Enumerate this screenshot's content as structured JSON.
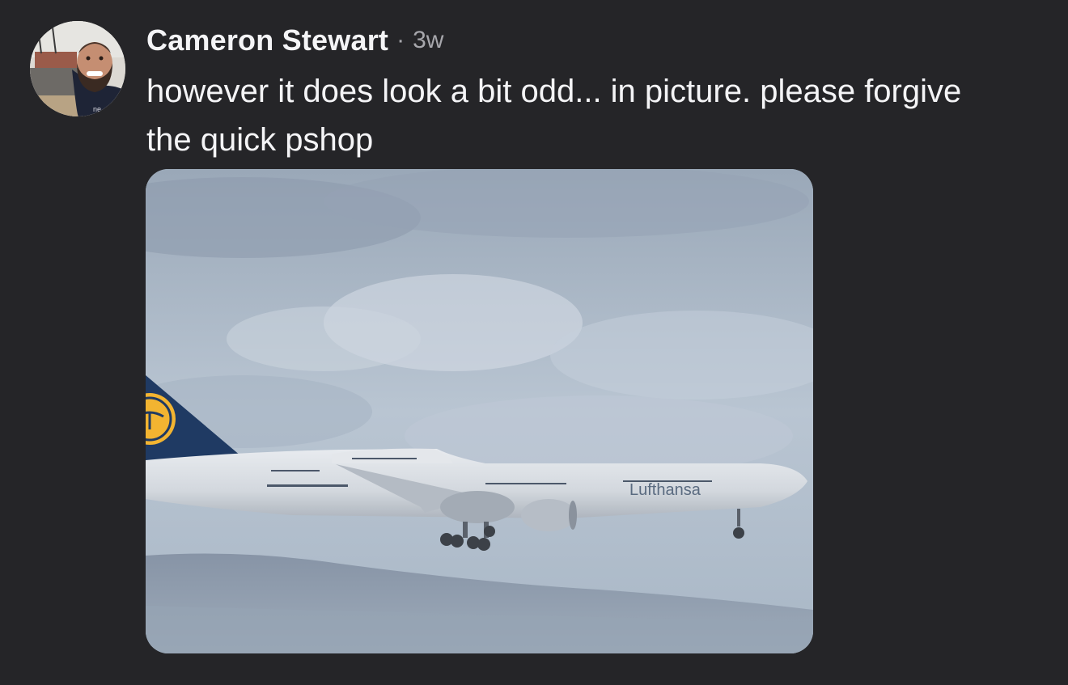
{
  "post": {
    "author": "Cameron Stewart",
    "separator": "·",
    "timestamp": "3w",
    "message": "however it does look a bit odd... in picture. please forgive the quick pshop"
  },
  "avatar": {
    "icon": "profile-photo",
    "shirt_text": "ne"
  },
  "attachment": {
    "icon": "airplane-photo",
    "airline_livery_text": "Lufthansa"
  },
  "colors": {
    "background": "#252528",
    "text_primary": "#f4f4f6",
    "text_secondary": "#a7a7ac",
    "lufthansa_tail": "#1f3a63",
    "lufthansa_logo": "#f2b431"
  }
}
